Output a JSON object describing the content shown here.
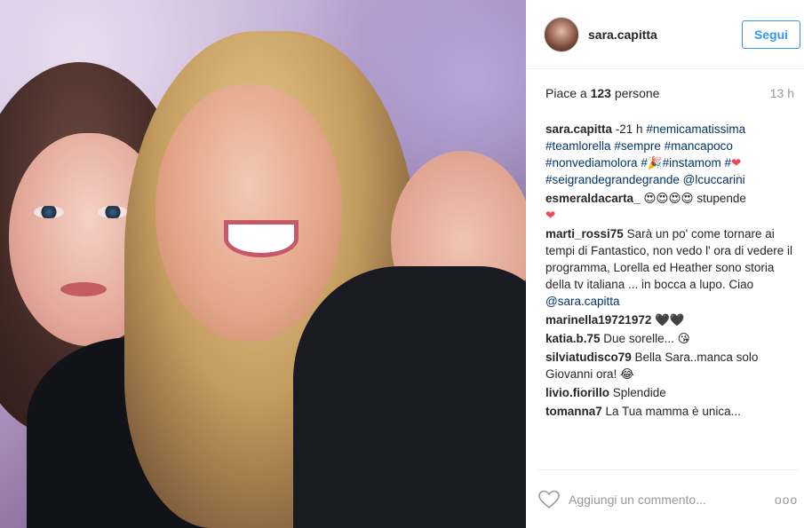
{
  "post": {
    "username": "sara.capitta",
    "follow_label": "Segui",
    "likes_prefix": "Piace a ",
    "likes_count": "123",
    "likes_suffix": " persone",
    "time_ago": "13 h"
  },
  "caption": {
    "user": "sara.capitta",
    "text1": " -21 h ",
    "tag1": "#nemicamatissima",
    "tag2": "#teamlorella",
    "tag3": "#sempre",
    "tag4": "#mancapoco",
    "tag5": "#nonvediamolora",
    "tag6": "#",
    "emoji1": "🎉",
    "tag7": "#instamom",
    "tag8": "#",
    "emoji2": "❤",
    "tag9": "#seigrandegrandegrande",
    "mention": "@lcuccarini"
  },
  "comments": [
    {
      "user": "esmeraldacarta_",
      "text": " 😍😍😍😍 stupende",
      "extra": "❤"
    },
    {
      "user": "marti_rossi75",
      "text": " Sarà un po' come tornare ai tempi di Fantastico, non vedo l' ora di vedere il programma, Lorella ed Heather sono storia della tv italiana ... in bocca a lupo. Ciao ",
      "mention": "@sara.capitta"
    },
    {
      "user": "marinella19721972",
      "text": " 🖤🖤"
    },
    {
      "user": "katia.b.75",
      "text": " Due sorelle... 😘"
    },
    {
      "user": "silviatudisco79",
      "text": " Bella Sara..manca solo Giovanni ora! 😂"
    },
    {
      "user": "livio.fiorillo",
      "text": " Splendide"
    },
    {
      "user": "tomanna7",
      "text": " La Tua mamma è unica..."
    }
  ],
  "footer": {
    "comment_placeholder": "Aggiungi un commento...",
    "more_label": "ooo"
  },
  "icons": [
    "heart-outline-icon",
    "more-icon"
  ]
}
